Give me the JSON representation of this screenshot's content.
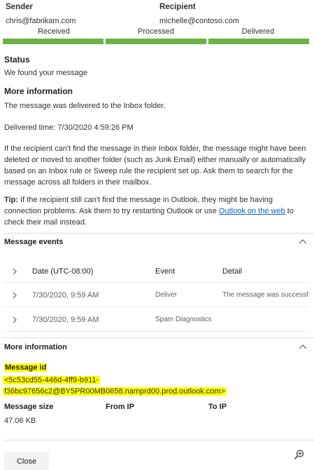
{
  "header": {
    "sender_label": "Sender",
    "recipient_label": "Recipient",
    "sender_email": "chris@fabrikam.com",
    "recipient_email": "michelle@contoso.com"
  },
  "progress": {
    "steps": [
      "Received",
      "Processed",
      "Delivered"
    ],
    "completed_steps": 3,
    "color": "#6bb344"
  },
  "status": {
    "title": "Status",
    "text": "We found your message"
  },
  "more_info": {
    "title": "More information",
    "delivered_text": "The message was delivered to the Inbox folder.",
    "delivered_time": "Delivered time: 7/30/2020 4:59:26 PM",
    "recipient_note": "If the recipient can't find the message in their Inbox folder, the message might have been deleted or moved to another folder (such as Junk Email) either manually or automatically based on an Inbox rule or Sweep rule the recipient set up. Ask them to search for the message across all folders in their mailbox.",
    "tip_label": "Tip:",
    "tip_text": " If the recipient still can't find the message in Outlook, they might be having connection problems. Ask them to try restarting Outlook or use ",
    "tip_link": "Outlook on the web",
    "tip_end": " to check their mail instead."
  },
  "message_events": {
    "title": "Message events",
    "columns": [
      "Date (UTC-08:00)",
      "Event",
      "Detail"
    ],
    "rows": [
      {
        "date": "7/30/2020, 9:59 AM",
        "event": "Deliver",
        "detail": "The message was successf..."
      },
      {
        "date": "7/30/2020, 9:59 AM",
        "event": "Spam Diagnostics",
        "detail": ""
      }
    ]
  },
  "details": {
    "title": "More information",
    "message_id_label": "Message id",
    "message_id_line1": "<5c53cd55-446d-4ff9-b911-",
    "message_id_line2": "f36bc97656c2@BY5PR00MB0658.namprd00.prod.outlook.com>",
    "highlight_color": "#ffff00",
    "message_size_label": "Message size",
    "from_ip_label": "From IP",
    "to_ip_label": "To IP",
    "message_size_value": "47.06 KB"
  },
  "footer": {
    "close_label": "Close",
    "zoom_icon": "zoom-in-icon"
  }
}
